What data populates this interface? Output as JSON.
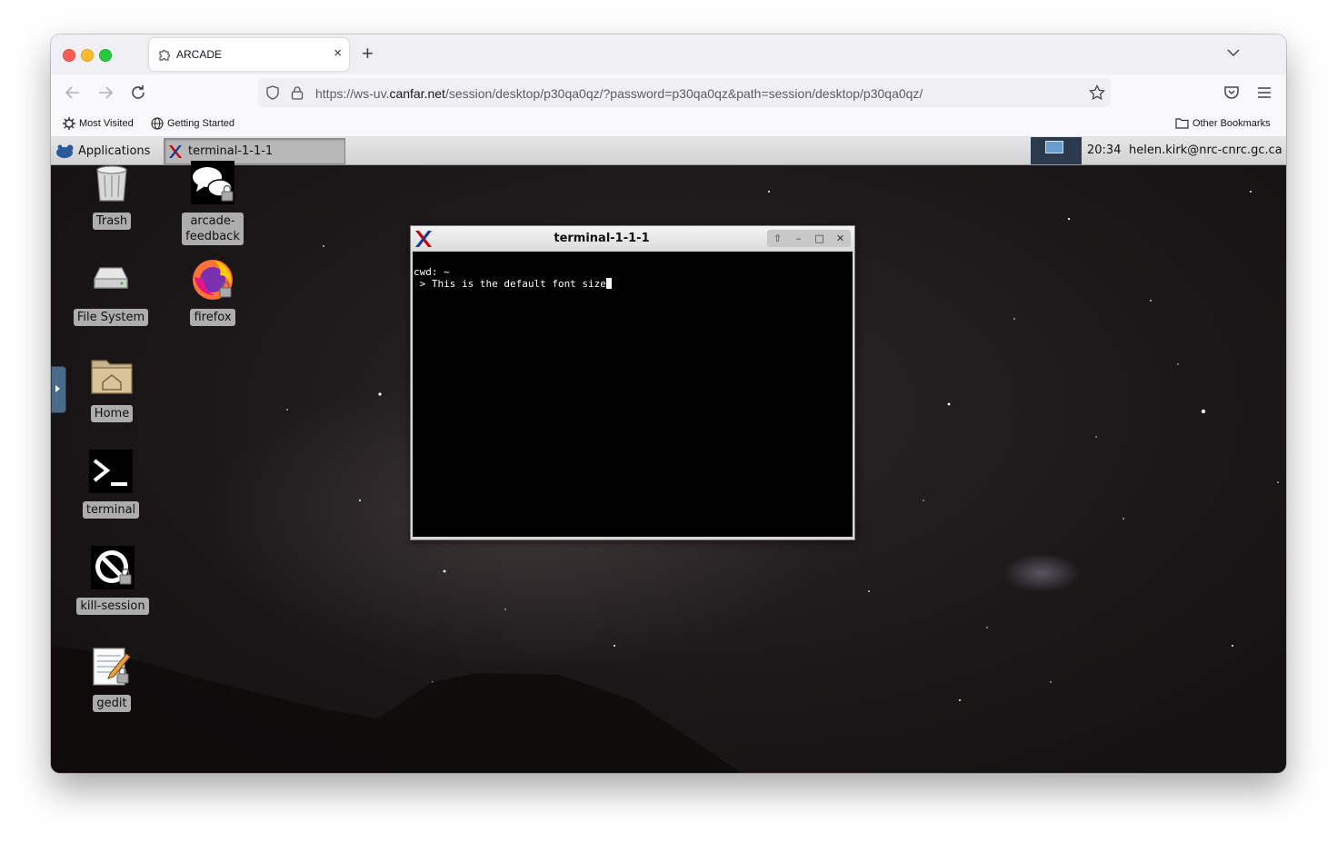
{
  "browser": {
    "tab": {
      "title": "ARCADE",
      "close": "×"
    },
    "new_tab": "+",
    "url": {
      "prefix": "https://ws-uv.",
      "host": "canfar.net",
      "path": "/session/desktop/p30qa0qz/?password=p30qa0qz&path=session/desktop/p30qa0qz/"
    },
    "bookmarks": [
      {
        "label": "Most Visited",
        "icon": "gear-icon"
      },
      {
        "label": "Getting Started",
        "icon": "globe-icon"
      }
    ],
    "other_bookmarks": "Other Bookmarks"
  },
  "desktop": {
    "panel": {
      "applications_label": "Applications",
      "task_label": "terminal-1-1-1",
      "clock": "20:34",
      "user": "helen.kirk@nrc-cnrc.gc.ca"
    },
    "icons_col1": [
      {
        "label": "Trash",
        "icon": "trash-icon"
      },
      {
        "label": "File System",
        "icon": "drive-icon"
      },
      {
        "label": "Home",
        "icon": "home-folder-icon"
      },
      {
        "label": "terminal",
        "icon": "terminal-icon"
      },
      {
        "label": "kill-session",
        "icon": "kill-session-icon"
      },
      {
        "label": "gedit",
        "icon": "gedit-icon"
      }
    ],
    "icons_col2": [
      {
        "label": "arcade-\nfeedback",
        "icon": "chat-bubbles-icon"
      },
      {
        "label": "firefox",
        "icon": "firefox-icon"
      }
    ]
  },
  "terminal": {
    "title": "terminal-1-1-1",
    "buttons": [
      "⇧",
      "–",
      "□",
      "✕"
    ],
    "lines": [
      "cwd: ~",
      " > This is the default font size"
    ]
  }
}
